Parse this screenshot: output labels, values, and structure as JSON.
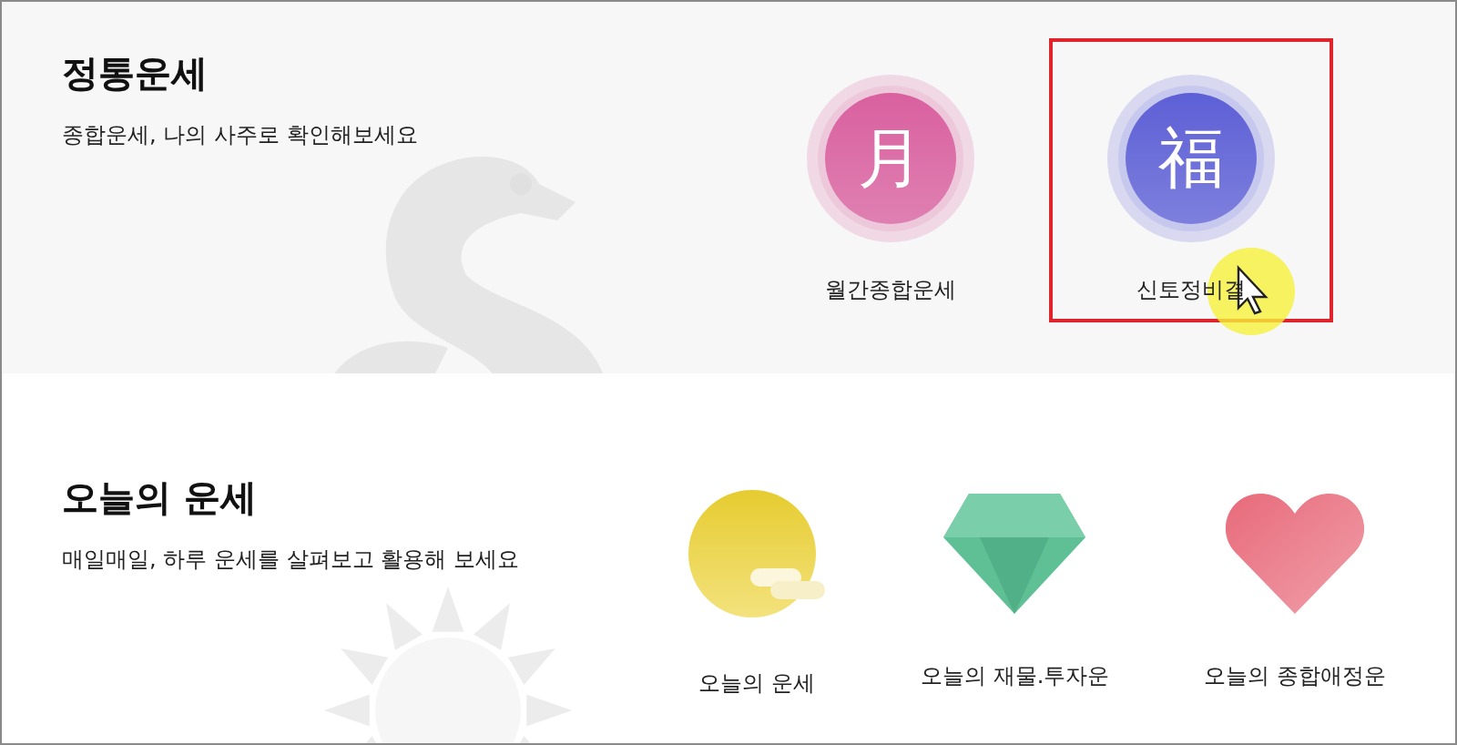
{
  "sections": [
    {
      "title": "정통운세",
      "subtitle": "종합운세, 나의 사주로 확인해보세요",
      "kind": "dragon",
      "items": [
        {
          "label": "월간종합운세",
          "kind": "glyph",
          "glyph": "月",
          "color": "#d9609f",
          "highlighted": false,
          "pointer": false
        },
        {
          "label": "신토정비결",
          "kind": "glyph",
          "glyph": "福",
          "color": "#5d5fd6",
          "highlighted": true,
          "pointer": true
        }
      ]
    },
    {
      "title": "오늘의 운세",
      "subtitle": "매일매일, 하루 운세를 살펴보고 활용해 보세요",
      "kind": "sun",
      "items": [
        {
          "label": "오늘의 운세",
          "kind": "sun"
        },
        {
          "label": "오늘의 재물.투자운",
          "kind": "gem"
        },
        {
          "label": "오늘의 종합애정운",
          "kind": "heart"
        }
      ]
    }
  ]
}
